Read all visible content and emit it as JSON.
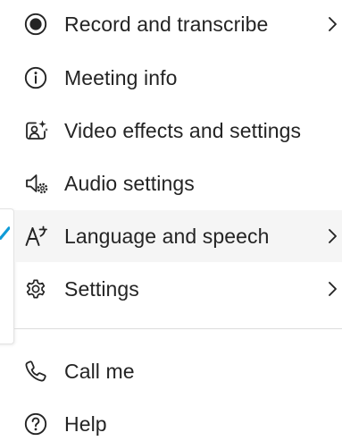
{
  "menu": {
    "items": [
      {
        "label": "Record and transcribe",
        "icon": "record-icon",
        "has_submenu": true
      },
      {
        "label": "Meeting info",
        "icon": "info-icon",
        "has_submenu": false
      },
      {
        "label": "Video effects and settings",
        "icon": "video-effects-icon",
        "has_submenu": false
      },
      {
        "label": "Audio settings",
        "icon": "audio-settings-icon",
        "has_submenu": false
      },
      {
        "label": "Language and speech",
        "icon": "language-icon",
        "has_submenu": true
      },
      {
        "label": "Settings",
        "icon": "gear-icon",
        "has_submenu": true
      },
      {
        "label": "Call me",
        "icon": "phone-icon",
        "has_submenu": false
      },
      {
        "label": "Help",
        "icon": "help-icon",
        "has_submenu": false
      }
    ],
    "hovered_item": "Language and speech"
  },
  "colors": {
    "text": "#242424",
    "hover_background": "#f5f5f5",
    "divider": "#dcdcdc",
    "accent": "#0f9bd7"
  }
}
